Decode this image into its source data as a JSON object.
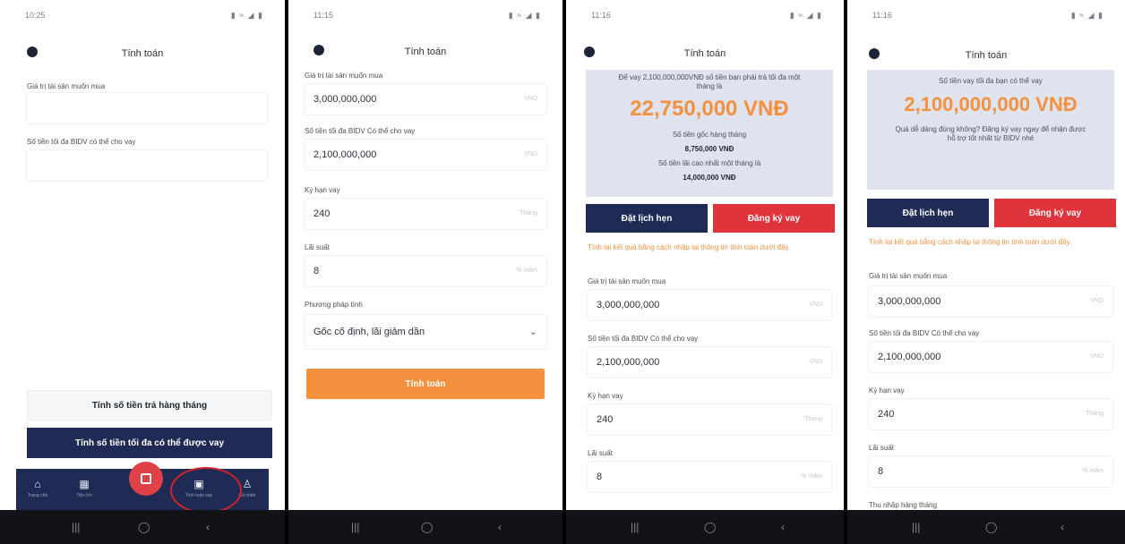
{
  "status": {
    "p1_time": "10:25",
    "p2_time": "11:15",
    "p3_time": "11:16",
    "p4_time": "11:16",
    "icons": "▮ ≈ ◢ ▮"
  },
  "screen_title": "Tính toán",
  "fields": {
    "asset_value_label": "Giá trị tài sản muốn mua",
    "max_loan_label": "Số tiền tối đa BIDV có thể cho vay",
    "max_loan_label_b": "Số tiền tối đa BIDV Có thể cho vay",
    "term_label": "Kỳ hạn vay",
    "rate_label": "Lãi suất",
    "method_label": "Phương pháp tính",
    "income_label": "Thu nhập hàng tháng"
  },
  "values": {
    "asset_value": "3,000,000,000",
    "max_loan": "2,100,000,000",
    "term": "240",
    "rate": "8",
    "method": "Gốc cố định, lãi giảm dần"
  },
  "units": {
    "currency": "VND",
    "term": "Tháng",
    "rate": "% /năm"
  },
  "buttons": {
    "calc_monthly": "Tính số tiền trả hàng tháng",
    "calc_max": "Tính số tiền tối đa có thể được vay",
    "calculate": "Tính toán",
    "book_appointment": "Đặt lịch hẹn",
    "register_loan": "Đăng ký vay"
  },
  "bottom_nav": {
    "home": "Trang chủ",
    "utility": "Tiện ích",
    "calculator": "Tính toán vay",
    "account": "Cá nhân"
  },
  "result_monthly": {
    "intro": "Để vay 2,100,000,000VNĐ số tiền bạn phải trả tối đa một tháng là",
    "amount": "22,750,000 VNĐ",
    "principal_label": "Số tiền gốc hàng tháng",
    "principal": "8,750,000 VNĐ",
    "interest_label": "Số tiền lãi cao nhất một tháng là",
    "interest": "14,000,000 VNĐ"
  },
  "result_max": {
    "intro": "Số tiền vay tối đa bạn có thể vay",
    "amount": "2,100,000,000 VNĐ",
    "cta": "Quá dễ dàng đúng không? Đăng ký vay ngay để nhận được hỗ trợ tốt nhất từ BIDV nhé"
  },
  "recalc_note": "Tính lại kết quả bằng cách nhập lại thông tin tính toán dưới đây.",
  "colors": {
    "navy": "#1f2b55",
    "orange": "#f5913e",
    "red": "#e0343c",
    "annotation": "#d0232a"
  }
}
